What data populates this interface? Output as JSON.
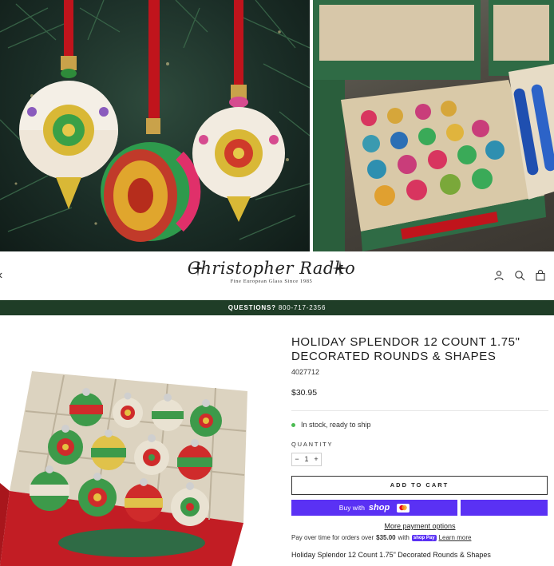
{
  "brand": {
    "name": "Christopher Radko",
    "tagline": "Fine European Glass Since 1985"
  },
  "nav": {
    "back_icon": "chevron-left-icon",
    "login_icon": "user-icon",
    "search_icon": "search-icon",
    "cart_icon": "bag-icon"
  },
  "announcement": {
    "label": "QUESTIONS?",
    "phone": "800-717-2356",
    "bg_color": "#1f3d27"
  },
  "product": {
    "title": "HOLIDAY SPLENDOR 12 COUNT 1.75\" DECORATED ROUNDS & SHAPES",
    "sku": "4027712",
    "price": "$30.95",
    "stock": "In stock, ready to ship",
    "quantity_label": "QUANTITY",
    "quantity_minus": "−",
    "quantity_value": "1",
    "quantity_plus": "+",
    "add_to_cart": "ADD TO CART",
    "buy_with": "Buy with",
    "shop_word": "shop",
    "more_payment": "More payment options",
    "pay_over_prefix": "Pay over time for orders over",
    "pay_over_amount": "$35.00",
    "pay_over_with": "with",
    "shoppay_badge": "shop Pay",
    "learn_more": "Learn more",
    "description": "Holiday Splendor 12 Count 1.75\" Decorated Rounds & Shapes"
  },
  "colors": {
    "accent_purple": "#5a31f4",
    "stock_green": "#4cbb52",
    "ribbon_red": "#c0141c"
  }
}
